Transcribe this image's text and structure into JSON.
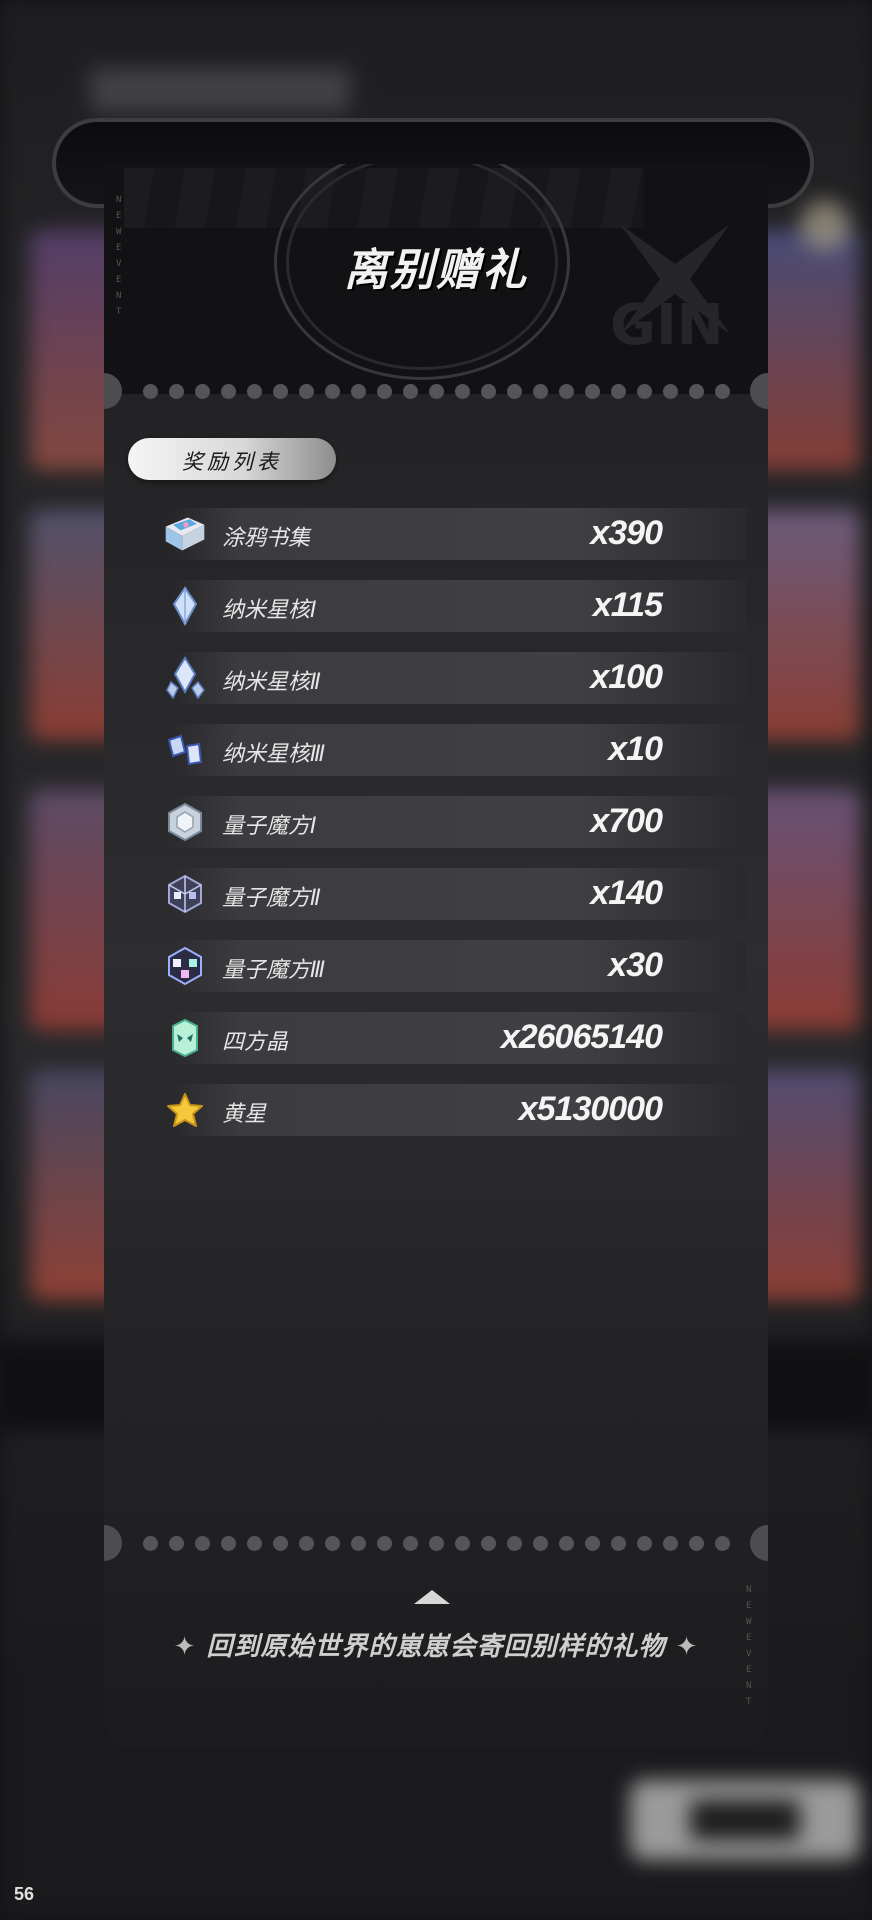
{
  "popup": {
    "title": "离别赠礼",
    "subtitle": "奖励列表",
    "footer_message": "回到原始世界的崽崽会寄回别样的礼物",
    "footer_star": "✦"
  },
  "rewards": [
    {
      "name": "涂鸦书集",
      "qty": "x390",
      "icon": "book-icon"
    },
    {
      "name": "纳米星核Ⅰ",
      "qty": "x115",
      "icon": "crystal-small-icon"
    },
    {
      "name": "纳米星核Ⅱ",
      "qty": "x100",
      "icon": "crystal-cluster-icon"
    },
    {
      "name": "纳米星核Ⅲ",
      "qty": "x10",
      "icon": "crystal-pair-icon"
    },
    {
      "name": "量子魔方Ⅰ",
      "qty": "x700",
      "icon": "cube-white-icon"
    },
    {
      "name": "量子魔方Ⅱ",
      "qty": "x140",
      "icon": "cube-dark-icon"
    },
    {
      "name": "量子魔方Ⅲ",
      "qty": "x30",
      "icon": "cube-prism-icon"
    },
    {
      "name": "四方晶",
      "qty": "x26065140",
      "icon": "green-crystal-icon"
    },
    {
      "name": "黄星",
      "qty": "x5130000",
      "icon": "yellow-star-icon"
    }
  ],
  "status": {
    "fps": "56"
  },
  "colors": {
    "panel": "#2d2d30",
    "header": "#121214",
    "row": "#3c3c40",
    "text": "#e6e6e6"
  }
}
